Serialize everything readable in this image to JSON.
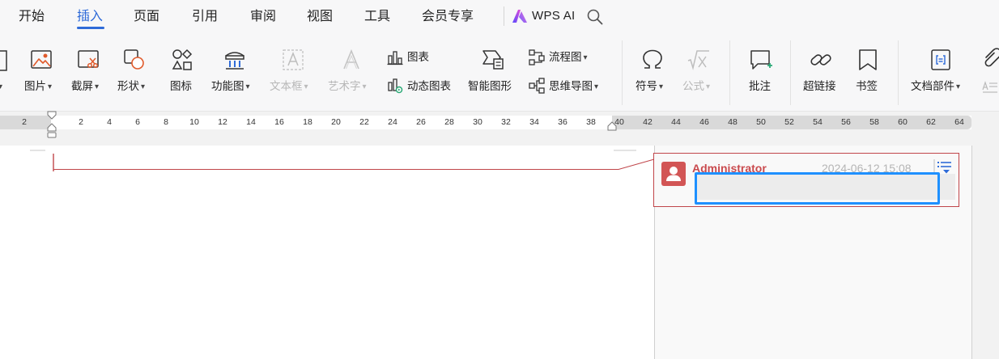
{
  "menubar": {
    "tabs": [
      {
        "label": "开始"
      },
      {
        "label": "插入"
      },
      {
        "label": "页面"
      },
      {
        "label": "引用"
      },
      {
        "label": "审阅"
      },
      {
        "label": "视图"
      },
      {
        "label": "工具"
      },
      {
        "label": "会员专享"
      }
    ],
    "active_tab": "插入",
    "wps_ai_label": "WPS AI"
  },
  "ribbon": {
    "picture": {
      "label": "图片"
    },
    "screenshot": {
      "label": "截屏"
    },
    "shape": {
      "label": "形状"
    },
    "icon": {
      "label": "图标"
    },
    "function_chart": {
      "label": "功能图"
    },
    "text_box": {
      "label": "文本框"
    },
    "word_art": {
      "label": "艺术字"
    },
    "chart": {
      "label": "图表"
    },
    "dynamic_chart": {
      "label": "动态图表"
    },
    "smart_shape": {
      "label": "智能图形"
    },
    "flowchart": {
      "label": "流程图"
    },
    "mind_map": {
      "label": "思维导图"
    },
    "symbol": {
      "label": "符号"
    },
    "formula": {
      "label": "公式"
    },
    "comment": {
      "label": "批注"
    },
    "hyperlink": {
      "label": "超链接"
    },
    "bookmark": {
      "label": "书签"
    },
    "doc_parts": {
      "label": "文档部件"
    }
  },
  "ruler": {
    "left_ticks": [
      "2"
    ],
    "ticks": [
      "2",
      "4",
      "6",
      "8",
      "10",
      "12",
      "14",
      "16",
      "18",
      "20",
      "22",
      "24",
      "26",
      "28",
      "30",
      "32",
      "34",
      "36",
      "38",
      "40",
      "42",
      "44",
      "46",
      "48",
      "50",
      "52",
      "54",
      "56",
      "58",
      "60",
      "62",
      "64"
    ]
  },
  "comment": {
    "author": "Administrator",
    "timestamp": "2024-06-12 15:08",
    "text": ""
  },
  "colors": {
    "accent": "#2f6bd8",
    "comment_border": "#c0454a",
    "comment_author": "#c94a4e",
    "focus_ring": "#1e90ff"
  }
}
